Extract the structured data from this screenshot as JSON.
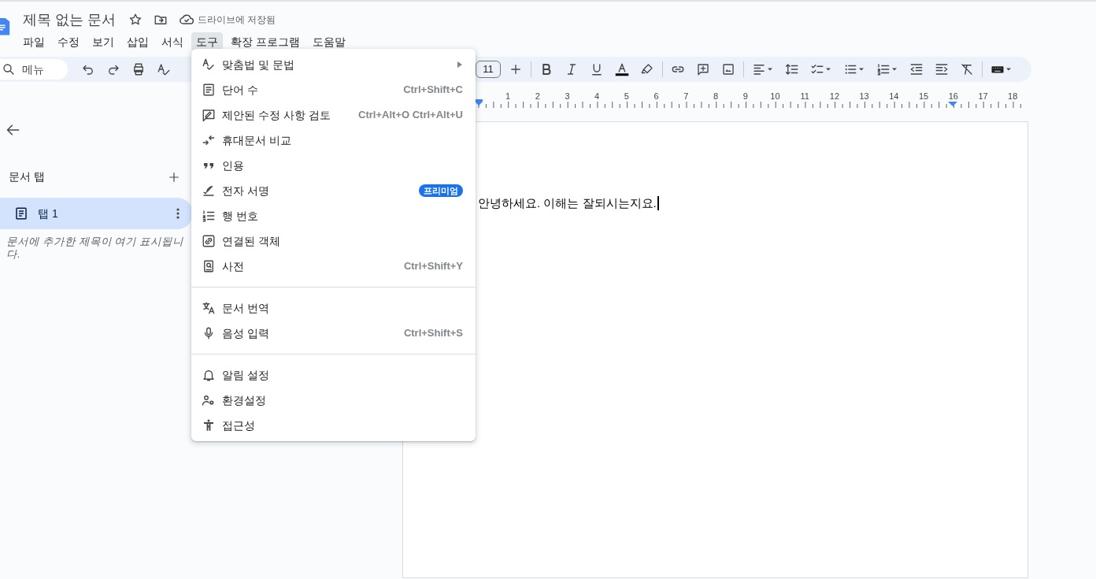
{
  "document": {
    "title": "제목 없는 문서",
    "save_status": "드라이브에 저장됨",
    "body_text": "안녕하세요. 이해는 잘되시는지요."
  },
  "menubar": [
    {
      "label": "파일",
      "selected": false
    },
    {
      "label": "수정",
      "selected": false
    },
    {
      "label": "보기",
      "selected": false
    },
    {
      "label": "삽입",
      "selected": false
    },
    {
      "label": "서식",
      "selected": false
    },
    {
      "label": "도구",
      "selected": true
    },
    {
      "label": "확장 프로그램",
      "selected": false
    },
    {
      "label": "도움말",
      "selected": false
    }
  ],
  "toolbar": {
    "search_placeholder": "메뉴",
    "font_size": "11"
  },
  "ruler": {
    "labels": [
      "1",
      "2",
      "3",
      "4",
      "5",
      "6",
      "7",
      "8",
      "9",
      "10",
      "11",
      "12",
      "13",
      "14",
      "15",
      "16",
      "17",
      "18"
    ]
  },
  "sidebar": {
    "heading": "문서 탭",
    "tabs": [
      {
        "label": "탭 1",
        "selected": true
      }
    ],
    "hint": "문서에 추가한 제목이 여기 표시됩니다."
  },
  "tools_menu": [
    {
      "kind": "item",
      "label": "맞춤법 및 문법",
      "submenu": true
    },
    {
      "kind": "item",
      "label": "단어 수",
      "shortcut": "Ctrl+Shift+C"
    },
    {
      "kind": "item",
      "label": "제안된 수정 사항 검토",
      "shortcut": "Ctrl+Alt+O Ctrl+Alt+U"
    },
    {
      "kind": "item",
      "label": "휴대문서 비교"
    },
    {
      "kind": "item",
      "label": "인용"
    },
    {
      "kind": "item",
      "label": "전자 서명",
      "badge": "프리미엄"
    },
    {
      "kind": "item",
      "label": "행 번호"
    },
    {
      "kind": "item",
      "label": "연결된 객체"
    },
    {
      "kind": "item",
      "label": "사전",
      "shortcut": "Ctrl+Shift+Y"
    },
    {
      "kind": "divider"
    },
    {
      "kind": "item",
      "label": "문서 번역"
    },
    {
      "kind": "item",
      "label": "음성 입력",
      "shortcut": "Ctrl+Shift+S"
    },
    {
      "kind": "divider"
    },
    {
      "kind": "item",
      "label": "알림 설정"
    },
    {
      "kind": "item",
      "label": "환경설정"
    },
    {
      "kind": "item",
      "label": "접근성"
    }
  ]
}
